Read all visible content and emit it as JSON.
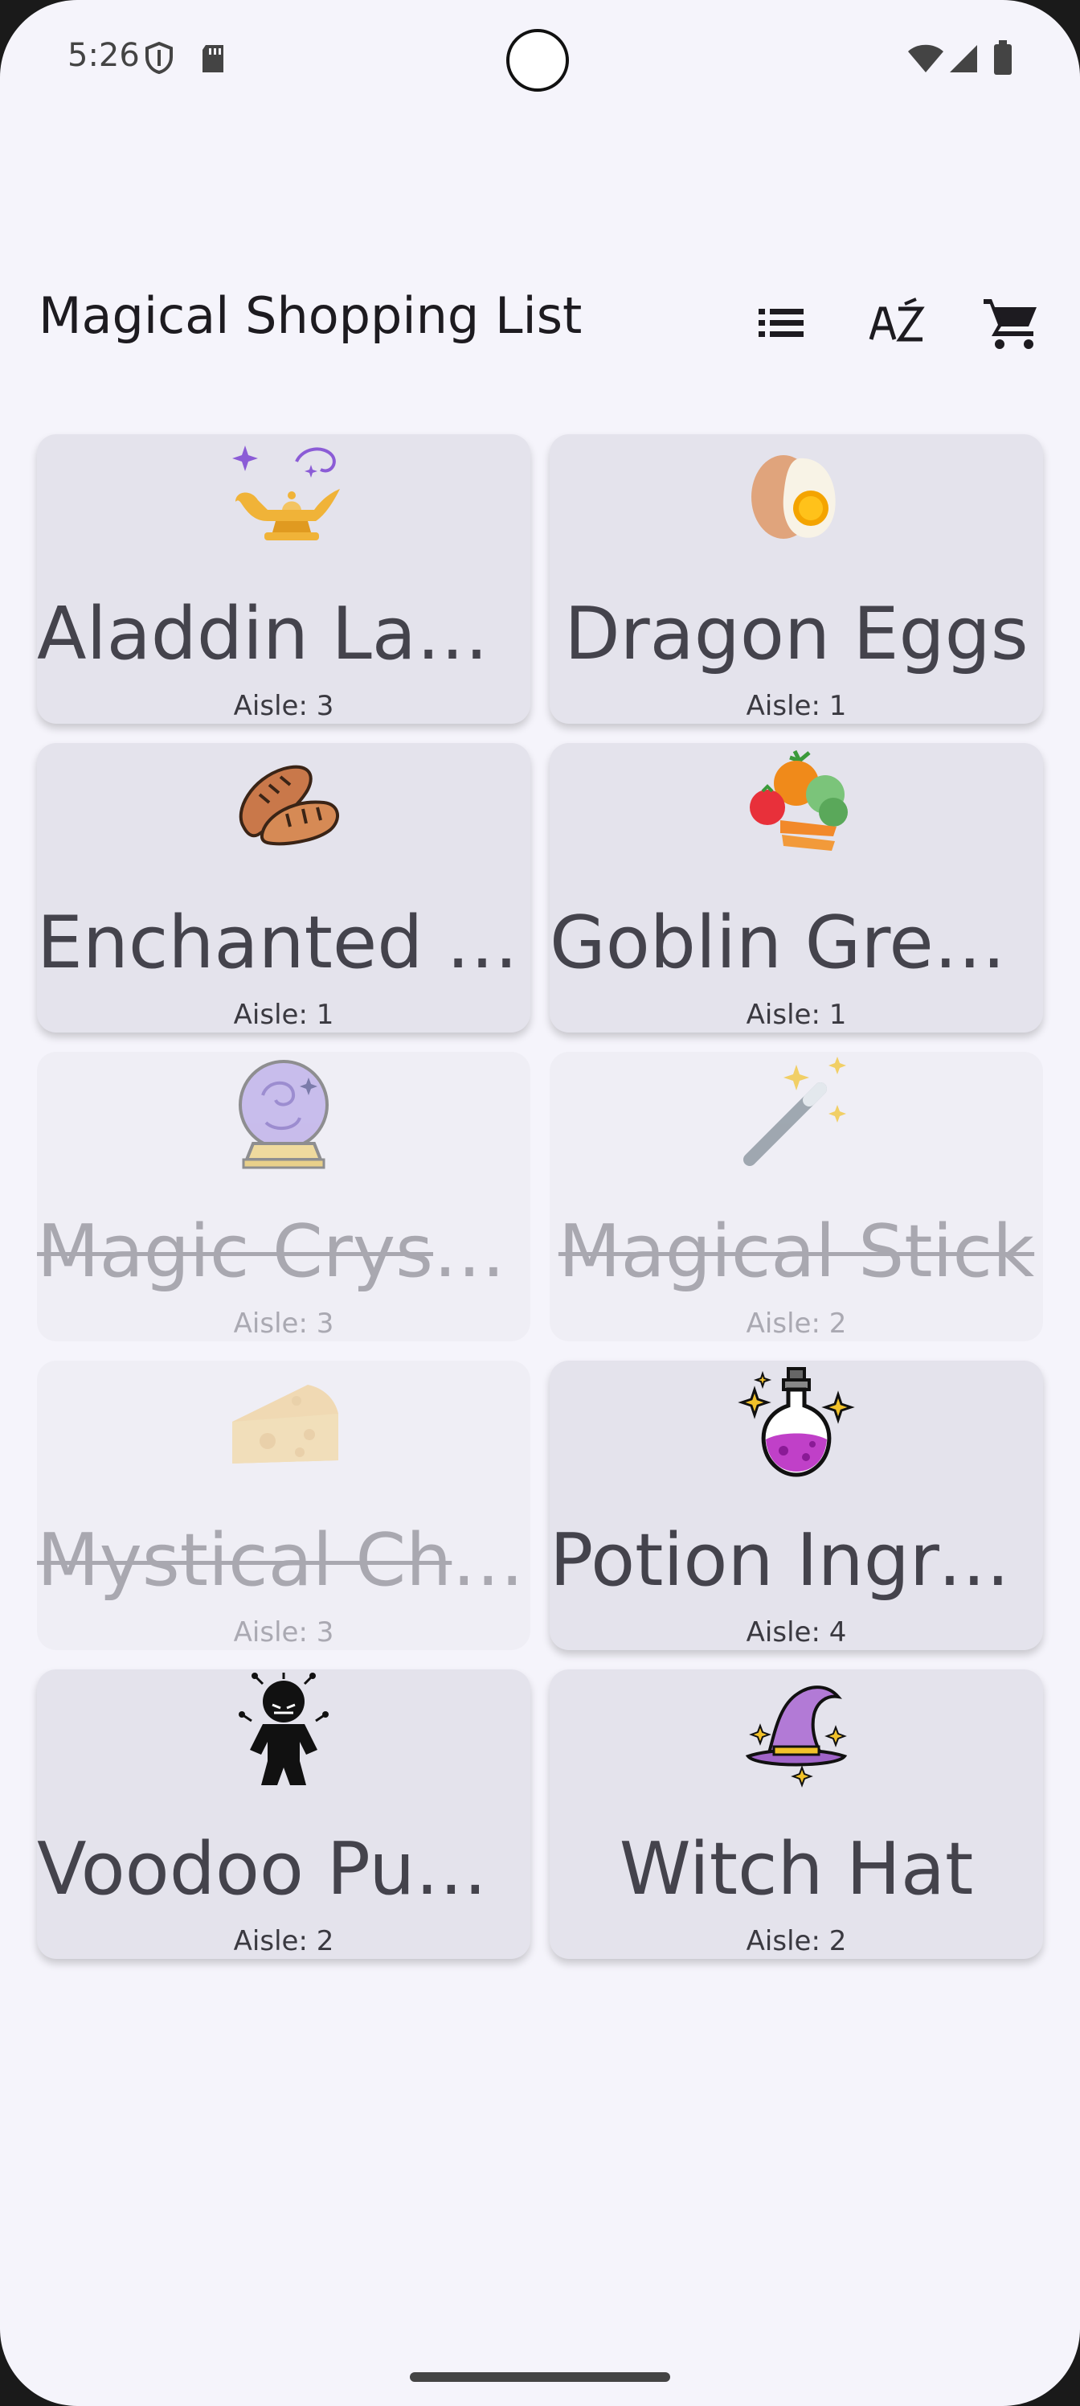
{
  "status_bar": {
    "time": "5:26"
  },
  "app_bar": {
    "title": "Magical Shopping List",
    "actions": [
      "list-view-icon",
      "sort-az-icon",
      "cart-icon"
    ]
  },
  "items": [
    {
      "name": "Aladdin Lamp",
      "aisle": "Aisle: 3",
      "icon": "magic-lamp-icon",
      "checked": false
    },
    {
      "name": "Dragon Eggs",
      "aisle": "Aisle: 1",
      "icon": "egg-icon",
      "checked": false
    },
    {
      "name": "Enchanted Bread",
      "aisle": "Aisle: 1",
      "icon": "bread-icon",
      "checked": false
    },
    {
      "name": "Goblin Greens",
      "aisle": "Aisle: 1",
      "icon": "vegetables-icon",
      "checked": false
    },
    {
      "name": "Magic Crystal Ball",
      "aisle": "Aisle: 3",
      "icon": "crystal-ball-icon",
      "checked": true
    },
    {
      "name": "Magical Stick",
      "aisle": "Aisle: 2",
      "icon": "magic-wand-icon",
      "checked": true
    },
    {
      "name": "Mystical Cheese",
      "aisle": "Aisle: 3",
      "icon": "cheese-icon",
      "checked": true
    },
    {
      "name": "Potion Ingredients",
      "aisle": "Aisle: 4",
      "icon": "potion-icon",
      "checked": false
    },
    {
      "name": "Voodoo Puppet",
      "aisle": "Aisle: 2",
      "icon": "voodoo-doll-icon",
      "checked": false
    },
    {
      "name": "Witch Hat",
      "aisle": "Aisle: 2",
      "icon": "witch-hat-icon",
      "checked": false
    }
  ]
}
